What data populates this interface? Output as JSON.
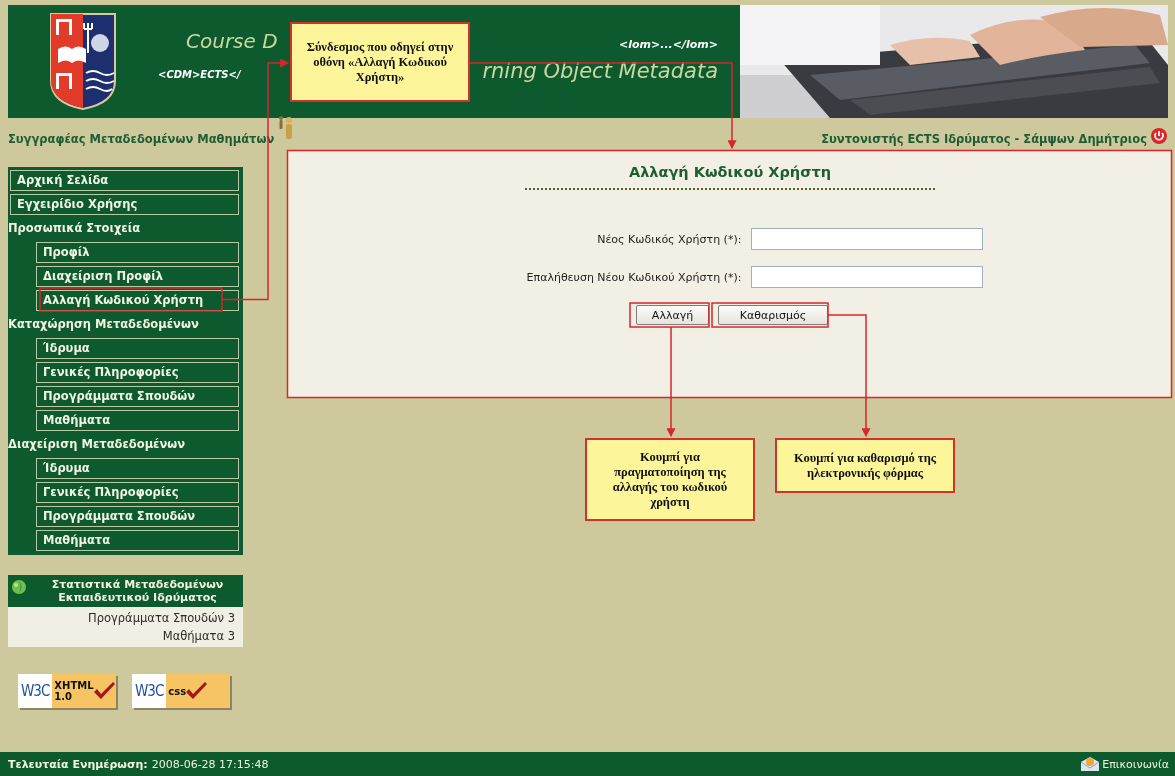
{
  "header": {
    "title_line_1": "Course D",
    "tag_text": "<lom>...</lom>",
    "title_line_2_left": "<CDM>ECTS</",
    "title_line_2_right": "rning Object Metadata"
  },
  "role_bar": {
    "left": "Συγγραφέας Μεταδεδομένων Μαθημάτων",
    "right": "Συντονιστής ECTS Ιδρύματος - Σάμψων Δημήτριος"
  },
  "sidebar": {
    "items": [
      {
        "kind": "link",
        "label": "Αρχική Σελίδα"
      },
      {
        "kind": "link",
        "label": "Εγχειρίδιο Χρήσης"
      },
      {
        "kind": "section",
        "label": "Προσωπικά Στοιχεία",
        "children": [
          {
            "label": "Προφίλ"
          },
          {
            "label": "Διαχείριση Προφίλ"
          },
          {
            "label": "Αλλαγή Κωδικού Χρήστη"
          }
        ]
      },
      {
        "kind": "section",
        "label": "Καταχώρηση Μεταδεδομένων",
        "children": [
          {
            "label": "Ίδρυμα"
          },
          {
            "label": "Γενικές Πληροφορίες"
          },
          {
            "label": "Προγράμματα Σπουδών"
          },
          {
            "label": "Μαθήματα"
          }
        ]
      },
      {
        "kind": "section",
        "label": "Διαχείριση Μεταδεδομένων",
        "children": [
          {
            "label": "Ίδρυμα"
          },
          {
            "label": "Γενικές Πληροφορίες"
          },
          {
            "label": "Προγράμματα Σπουδών"
          },
          {
            "label": "Μαθήματα"
          }
        ]
      }
    ]
  },
  "stats": {
    "title": "Στατιστικά Μεταδεδομένων Εκπαιδευτικού Ιδρύματος",
    "rows": [
      "Προγράμματα Σπουδών 3",
      "Μαθήματα 3"
    ]
  },
  "badges": [
    {
      "logo": "W3C",
      "lines": [
        "XHTML",
        "1.0"
      ]
    },
    {
      "logo": "W3C",
      "lines": [
        "css"
      ]
    }
  ],
  "form": {
    "title": "Αλλαγή Κωδικού Χρήστη",
    "fields": [
      {
        "label": "Νέος Κωδικός Χρήστη (*):"
      },
      {
        "label": "Επαλήθευση Νέου Κωδικού Χρήστη (*):"
      }
    ],
    "buttons": [
      "Αλλαγή",
      "Καθαρισμός"
    ]
  },
  "callouts": [
    "Σύνδεσμος που οδηγεί στην οθόνη «Αλλαγή Κωδικού Χρήστη»",
    "Κουμπί για πραγματοποίηση της αλλαγής του κωδικού χρήστη",
    "Κουμπί για καθαρισμό της ηλεκτρονικής φόρμας"
  ],
  "footer": {
    "label": "Τελευταία Ενημέρωση:",
    "value": "2008-06-28 17:15:48",
    "contact": "Επικοινωνία"
  }
}
